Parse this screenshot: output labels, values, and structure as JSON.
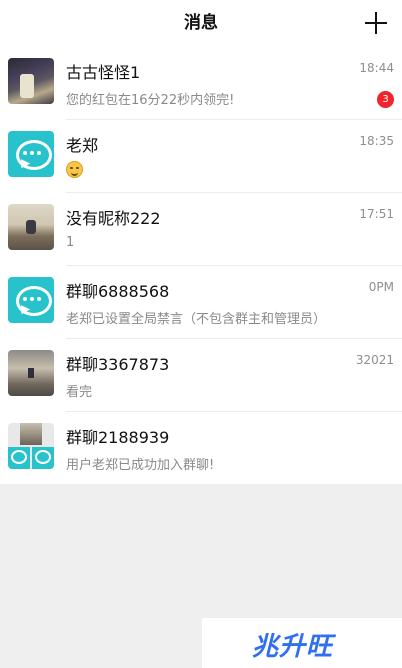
{
  "header": {
    "title": "消息",
    "add_icon": "plus-icon"
  },
  "conversations": [
    {
      "name": "古古怪怪1",
      "message": "您的红包在16分22秒内领完!",
      "time": "18:44",
      "badge": "3",
      "avatar": "photo"
    },
    {
      "name": "老郑",
      "message": "",
      "emoji": "smiling-face",
      "time": "18:35",
      "avatar": "chat-icon"
    },
    {
      "name": "没有昵称222",
      "message": "1",
      "time": "17:51",
      "avatar": "photo"
    },
    {
      "name": "群聊6888568",
      "message": "老郑已设置全局禁言（不包含群主和管理员）",
      "time": "0PM",
      "avatar": "chat-icon"
    },
    {
      "name": "群聊3367873",
      "message": "看完",
      "time": "32021",
      "avatar": "photo"
    },
    {
      "name": "群聊2188939",
      "message": "用户老郑已成功加入群聊!",
      "time": "",
      "avatar": "group-grid"
    }
  ],
  "watermark": {
    "text": "兆升旺"
  },
  "colors": {
    "accent": "#27c2cc",
    "badge": "#f0242a",
    "watermark": "#2f6ff0"
  }
}
